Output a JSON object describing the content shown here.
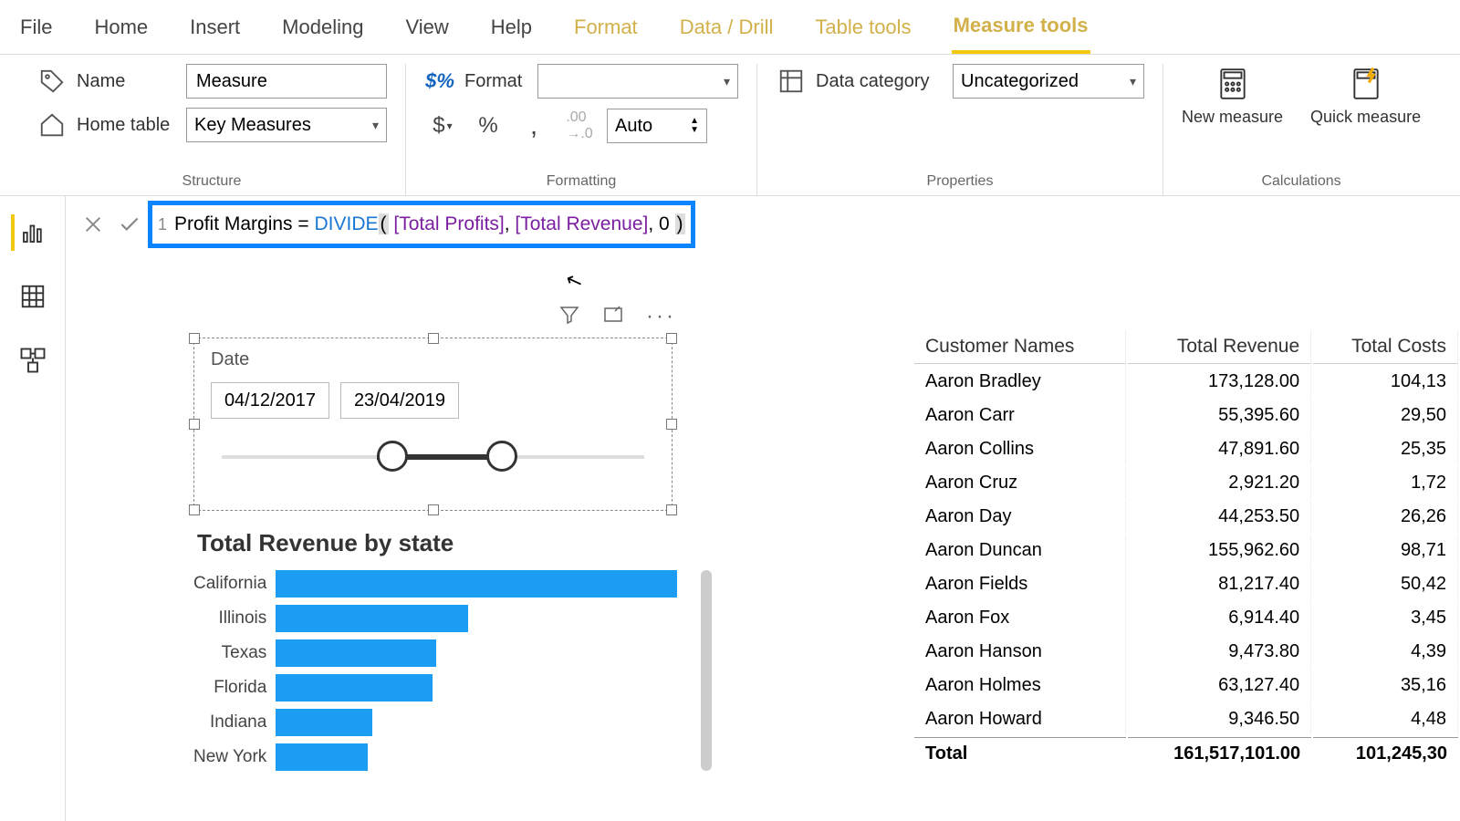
{
  "tabs": {
    "file": "File",
    "home": "Home",
    "insert": "Insert",
    "modeling": "Modeling",
    "view": "View",
    "help": "Help",
    "format": "Format",
    "data_drill": "Data / Drill",
    "table_tools": "Table tools",
    "measure_tools": "Measure tools"
  },
  "ribbon": {
    "structure": {
      "name_label": "Name",
      "name_value": "Measure",
      "home_table_label": "Home table",
      "home_table_value": "Key Measures",
      "group": "Structure"
    },
    "formatting": {
      "format_label": "Format",
      "format_value": "",
      "auto": "Auto",
      "group": "Formatting"
    },
    "properties": {
      "data_category_label": "Data category",
      "data_category_value": "Uncategorized",
      "group": "Properties"
    },
    "calculations": {
      "new_measure": "New measure",
      "quick_measure": "Quick measure",
      "group": "Calculations"
    }
  },
  "formula": {
    "line": "1",
    "prefix": "Profit Margins = ",
    "func": "DIVIDE",
    "open": "(",
    "arg_space": " ",
    "ref1": "[Total Profits]",
    "sep1": ", ",
    "ref2": "[Total Revenue]",
    "sep2": ", 0 ",
    "close": ")"
  },
  "slicer": {
    "title": "Date",
    "from": "04/12/2017",
    "to": "23/04/2019"
  },
  "chart_data": {
    "type": "bar",
    "title": "Total Revenue by state",
    "categories": [
      "California",
      "Illinois",
      "Texas",
      "Florida",
      "Indiana",
      "New York"
    ],
    "values": [
      100,
      48,
      40,
      39,
      24,
      23
    ],
    "xlabel": "",
    "ylabel": "",
    "ylim": [
      0,
      100
    ]
  },
  "table": {
    "headers": [
      "Customer Names",
      "Total Revenue",
      "Total Costs"
    ],
    "rows": [
      [
        "Aaron Bradley",
        "173,128.00",
        "104,13"
      ],
      [
        "Aaron Carr",
        "55,395.60",
        "29,50"
      ],
      [
        "Aaron Collins",
        "47,891.60",
        "25,35"
      ],
      [
        "Aaron Cruz",
        "2,921.20",
        "1,72"
      ],
      [
        "Aaron Day",
        "44,253.50",
        "26,26"
      ],
      [
        "Aaron Duncan",
        "155,962.60",
        "98,71"
      ],
      [
        "Aaron Fields",
        "81,217.40",
        "50,42"
      ],
      [
        "Aaron Fox",
        "6,914.40",
        "3,45"
      ],
      [
        "Aaron Hanson",
        "9,473.80",
        "4,39"
      ],
      [
        "Aaron Holmes",
        "63,127.40",
        "35,16"
      ],
      [
        "Aaron Howard",
        "9,346.50",
        "4,48"
      ]
    ],
    "total_label": "Total",
    "total_rev": "161,517,101.00",
    "total_cost": "101,245,30"
  }
}
